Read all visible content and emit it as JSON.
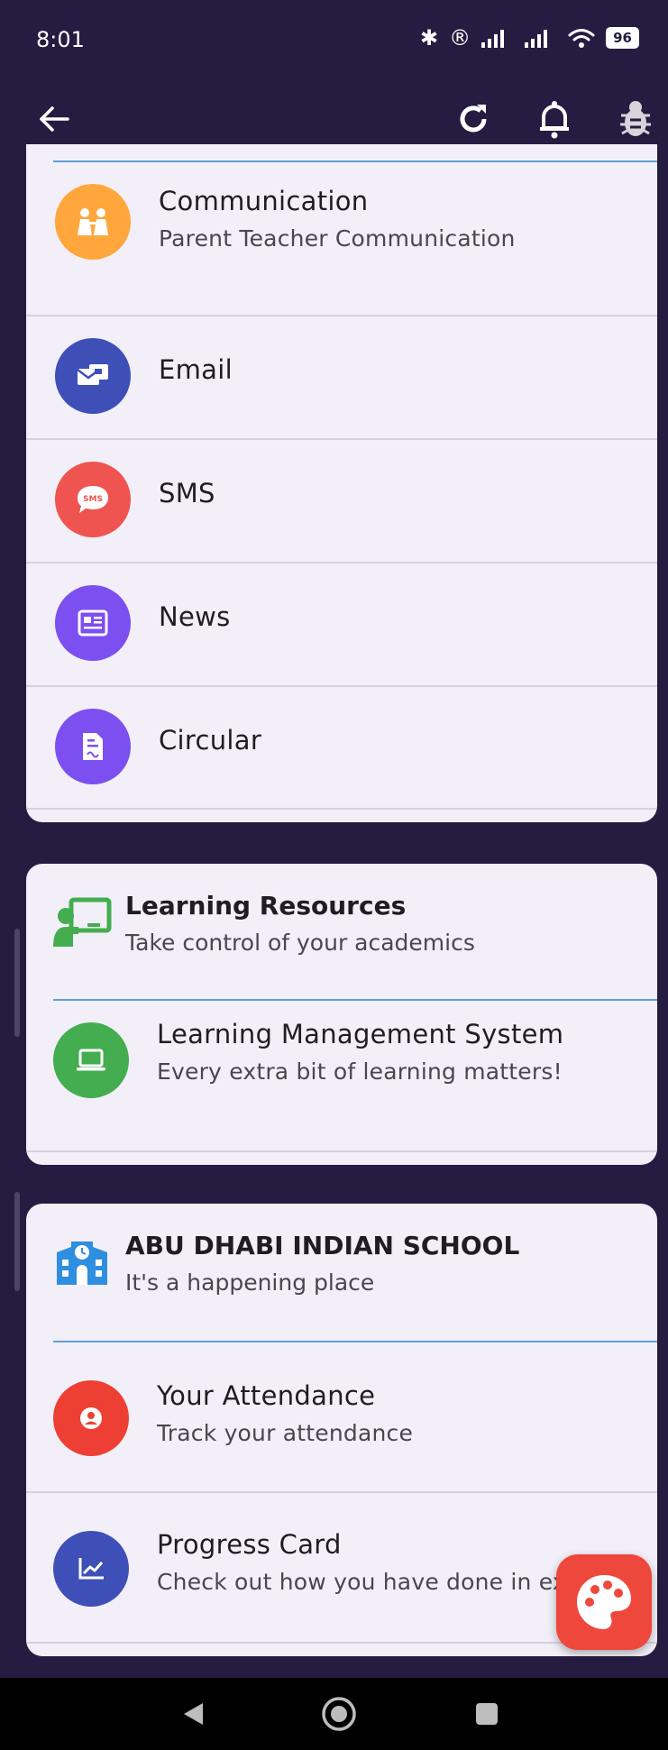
{
  "status_bar": {
    "time": "8:01",
    "battery": "96"
  },
  "communication_card": {
    "items": [
      {
        "title": "Communication",
        "subtitle": "Parent Teacher Communication",
        "icon": "people-icon",
        "color": "#ffa73c"
      },
      {
        "title": "Email",
        "icon": "email-icon",
        "color": "#3e4fb8"
      },
      {
        "title": "SMS",
        "icon": "sms-icon",
        "color": "#f05450"
      },
      {
        "title": "News",
        "icon": "news-icon",
        "color": "#7c4ff0"
      },
      {
        "title": "Circular",
        "icon": "document-icon",
        "color": "#7c4ff0"
      }
    ]
  },
  "learning_card": {
    "header": {
      "title": "Learning Resources",
      "subtitle": "Take control of your academics",
      "icon": "teacher-icon",
      "color": "#43ad4f"
    },
    "items": [
      {
        "title": "Learning Management System",
        "subtitle": "Every extra bit of learning matters!",
        "icon": "laptop-icon",
        "color": "#43ad4f"
      }
    ]
  },
  "school_card": {
    "header": {
      "title": "ABU DHABI INDIAN SCHOOL",
      "subtitle": "It's a happening place",
      "icon": "school-icon",
      "color": "#2e8ee0"
    },
    "items": [
      {
        "title": "Your Attendance",
        "subtitle": "Track your attendance",
        "icon": "attendance-icon",
        "color": "#ee3f35"
      },
      {
        "title": "Progress Card",
        "subtitle": "Check out how you have done in ex",
        "icon": "chart-icon",
        "color": "#3e4fb8"
      }
    ]
  },
  "fab": {
    "icon": "palette-icon",
    "color": "#ee473b"
  }
}
